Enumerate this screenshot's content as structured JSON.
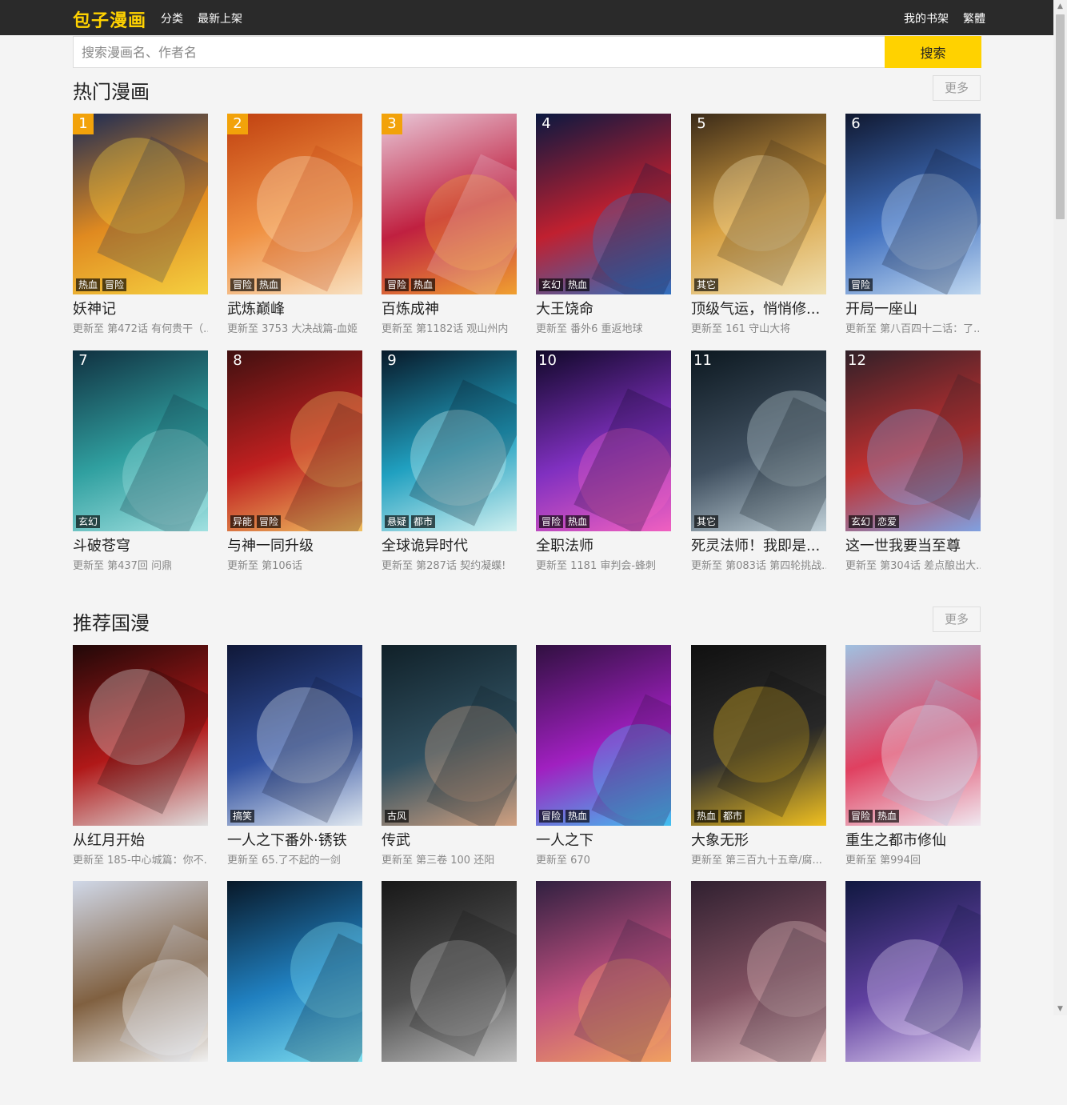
{
  "nav": {
    "logo": "包子漫画",
    "links": [
      "分类",
      "最新上架"
    ],
    "right_links": [
      "我的书架",
      "繁體"
    ]
  },
  "search": {
    "placeholder": "搜索漫画名、作者名",
    "button": "搜索"
  },
  "sections": [
    {
      "title": "热门漫画",
      "more": "更多",
      "items": [
        {
          "rank": "1",
          "title": "妖神记",
          "update": "更新至 第472话 有何贵干（...",
          "tags": [
            "热血",
            "冒险"
          ],
          "colors": [
            "#1a2a55",
            "#e08a20",
            "#f5d040"
          ]
        },
        {
          "rank": "2",
          "title": "武炼巅峰",
          "update": "更新至 3753 大决战篇-血姬",
          "tags": [
            "冒险",
            "热血"
          ],
          "colors": [
            "#c04010",
            "#f09040",
            "#f8e0c0"
          ]
        },
        {
          "rank": "3",
          "title": "百炼成神",
          "update": "更新至 第1182话 观山州内",
          "tags": [
            "冒险",
            "热血"
          ],
          "colors": [
            "#e8c8d8",
            "#c02040",
            "#f0a030"
          ]
        },
        {
          "rank": "4",
          "title": "大王饶命",
          "update": "更新至 番外6 重返地球",
          "tags": [
            "玄幻",
            "热血"
          ],
          "colors": [
            "#0a1840",
            "#c02030",
            "#3070c0"
          ]
        },
        {
          "rank": "5",
          "title": "顶级气运，悄悄修...",
          "update": "更新至 161 守山大将",
          "tags": [
            "其它"
          ],
          "colors": [
            "#3a2a18",
            "#d8a040",
            "#f0e0b0"
          ]
        },
        {
          "rank": "6",
          "title": "开局一座山",
          "update": "更新至 第八百四十二话：了...",
          "tags": [
            "冒险"
          ],
          "colors": [
            "#101830",
            "#4070c0",
            "#c0d8f0"
          ]
        },
        {
          "rank": "7",
          "title": "斗破苍穹",
          "update": "更新至 第437回 问鼎",
          "tags": [
            "玄幻"
          ],
          "colors": [
            "#103040",
            "#30a0a0",
            "#a0e0e0"
          ]
        },
        {
          "rank": "8",
          "title": "与神一同升级",
          "update": "更新至 第106话",
          "tags": [
            "异能",
            "冒险"
          ],
          "colors": [
            "#401010",
            "#c02020",
            "#f0c060"
          ]
        },
        {
          "rank": "9",
          "title": "全球诡异时代",
          "update": "更新至 第287话 契约凝蝶!",
          "tags": [
            "悬疑",
            "都市"
          ],
          "colors": [
            "#081828",
            "#20a0c0",
            "#d0f0f0"
          ]
        },
        {
          "rank": "10",
          "title": "全职法师",
          "update": "更新至 1181 审判会-蜂刺",
          "tags": [
            "冒险",
            "热血"
          ],
          "colors": [
            "#100828",
            "#8030c0",
            "#f060c0"
          ]
        },
        {
          "rank": "11",
          "title": "死灵法师！我即是...",
          "update": "更新至 第083话 第四轮挑战...",
          "tags": [
            "其它"
          ],
          "colors": [
            "#0c1820",
            "#405060",
            "#c0d0d8"
          ]
        },
        {
          "rank": "12",
          "title": "这一世我要当至尊",
          "update": "更新至 第304话 差点酿出大...",
          "tags": [
            "玄幻",
            "恋爱"
          ],
          "colors": [
            "#302028",
            "#c03030",
            "#80a0e0"
          ]
        }
      ]
    },
    {
      "title": "推荐国漫",
      "more": "更多",
      "items": [
        {
          "title": "从红月开始",
          "update": "更新至 185-中心城篇：你不...",
          "tags": [],
          "colors": [
            "#200808",
            "#b01818",
            "#e0e0e0"
          ]
        },
        {
          "title": "一人之下番外·锈铁",
          "update": "更新至 65.了不起的一剑",
          "tags": [
            "搞笑"
          ],
          "colors": [
            "#101838",
            "#3050a0",
            "#e0e8f0"
          ]
        },
        {
          "title": "传武",
          "update": "更新至 第三卷 100 还阳",
          "tags": [
            "古风"
          ],
          "colors": [
            "#102028",
            "#305060",
            "#d0a080"
          ]
        },
        {
          "title": "一人之下",
          "update": "更新至 670",
          "tags": [
            "冒险",
            "热血"
          ],
          "colors": [
            "#301040",
            "#a020c0",
            "#40c0f0"
          ]
        },
        {
          "title": "大象无形",
          "update": "更新至 第三百九十五章/腐...",
          "tags": [
            "热血",
            "都市"
          ],
          "colors": [
            "#101010",
            "#303030",
            "#f0c020"
          ]
        },
        {
          "title": "重生之都市修仙",
          "update": "更新至 第994回",
          "tags": [
            "冒险",
            "热血"
          ],
          "colors": [
            "#a0c0e0",
            "#e04060",
            "#f0e8f0"
          ]
        },
        {
          "title": "",
          "update": "",
          "tags": [],
          "colors": [
            "#d0d8e8",
            "#806040",
            "#f0f0f0"
          ]
        },
        {
          "title": "",
          "update": "",
          "tags": [],
          "colors": [
            "#081828",
            "#2080c0",
            "#80e0f0"
          ]
        },
        {
          "title": "",
          "update": "",
          "tags": [],
          "colors": [
            "#181818",
            "#505050",
            "#c0c0c0"
          ]
        },
        {
          "title": "",
          "update": "",
          "tags": [],
          "colors": [
            "#302040",
            "#c05080",
            "#f0a060"
          ]
        },
        {
          "title": "",
          "update": "",
          "tags": [],
          "colors": [
            "#302030",
            "#805060",
            "#e0c0c0"
          ]
        },
        {
          "title": "",
          "update": "",
          "tags": [],
          "colors": [
            "#101840",
            "#6040a0",
            "#e0d0f0"
          ]
        }
      ]
    }
  ]
}
